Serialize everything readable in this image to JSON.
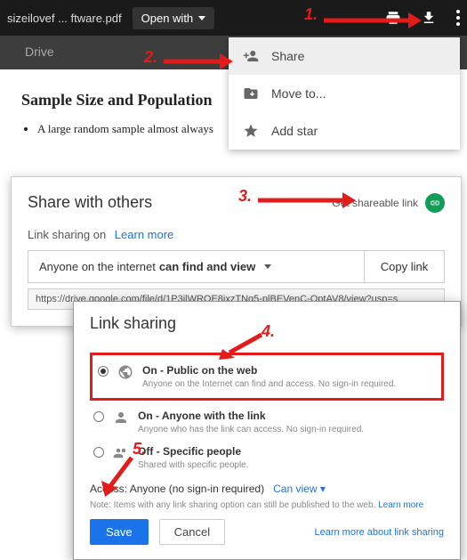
{
  "topbar": {
    "filename": "sizeilovef ... ftware.pdf",
    "open_with": "Open with"
  },
  "drive_label": "Drive",
  "dropdown": {
    "share": "Share",
    "move": "Move to...",
    "star": "Add star"
  },
  "document": {
    "heading": "Sample Size and Population",
    "bullet": "A large random sample almost always"
  },
  "share_panel": {
    "title": "Share with others",
    "get_link": "Get shareable link",
    "link_sharing_prefix": "Link sharing on",
    "learn_more": "Learn more",
    "perm_prefix": "Anyone on the internet",
    "perm_bold": "can find and view",
    "copy": "Copy link",
    "url": "https://drive.google.com/file/d/1P3ilWRQE8ixzTNq5-plBEVenC-QptAV8/view?usp=s"
  },
  "ls_dialog": {
    "title": "Link sharing",
    "opt1_title": "On - Public on the web",
    "opt1_sub": "Anyone on the Internet can find and access. No sign-in required.",
    "opt2_title": "On - Anyone with the link",
    "opt2_sub": "Anyone who has the link can access. No sign-in required.",
    "opt3_title": "Off - Specific people",
    "opt3_sub": "Shared with specific people.",
    "access_label": "Access:",
    "access_value": "Anyone (no sign-in required)",
    "can_view": "Can view",
    "note_prefix": "Note: Items with any link sharing option can still be published to the web.",
    "note_link": "Learn more",
    "save": "Save",
    "cancel": "Cancel",
    "learn_more_right": "Learn more about link sharing"
  },
  "callouts": {
    "c1": "1.",
    "c2": "2.",
    "c3": "3.",
    "c4": "4.",
    "c5": "5."
  }
}
